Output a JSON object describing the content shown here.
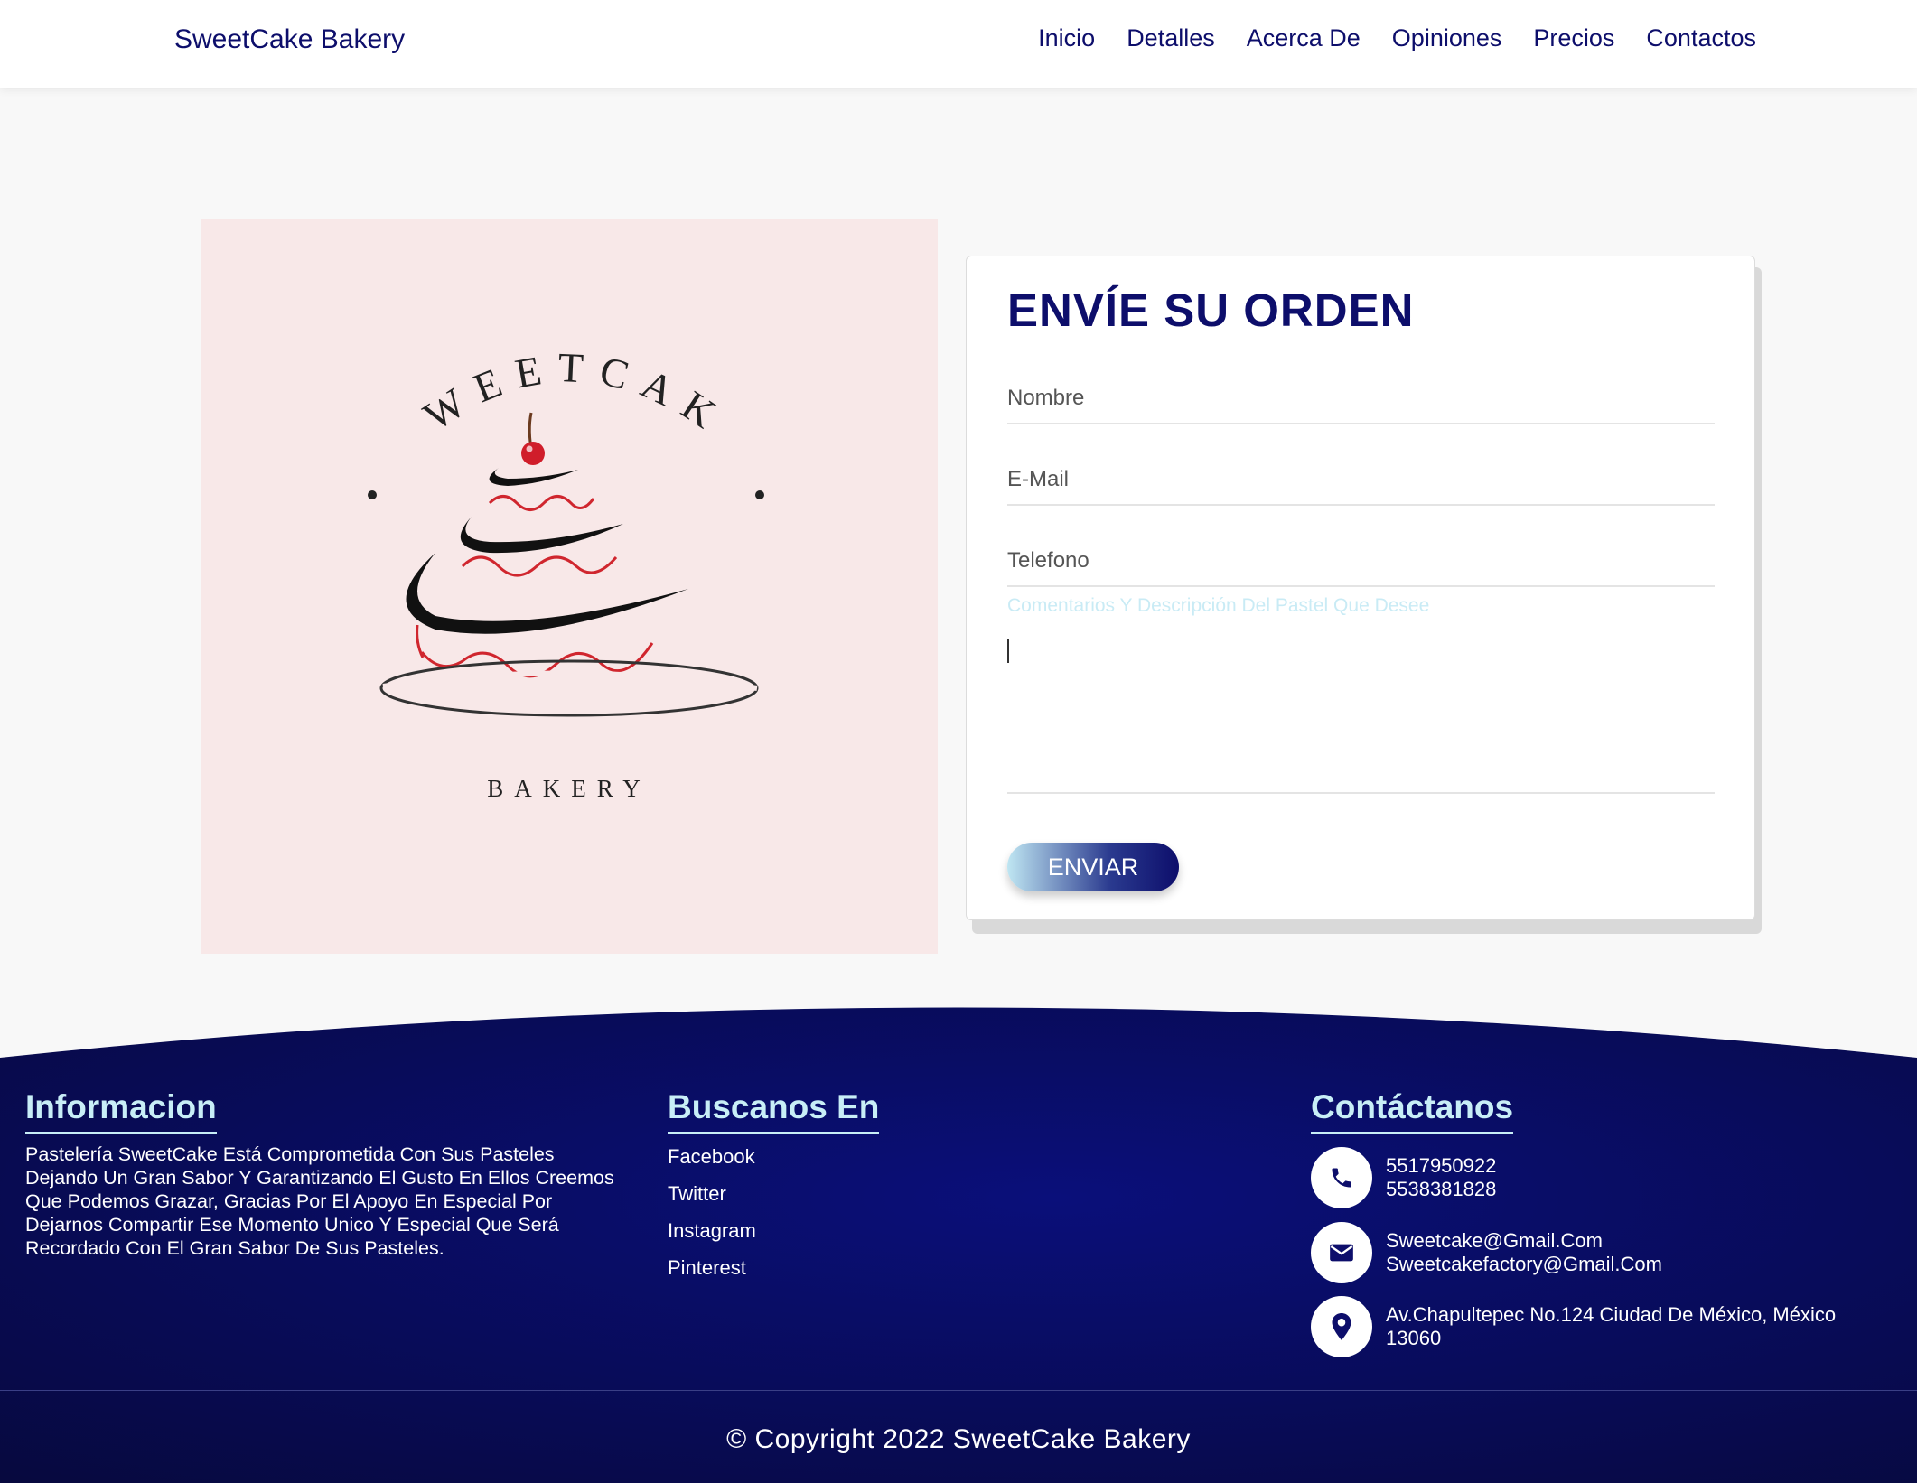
{
  "navbar": {
    "brand": "SweetCake Bakery",
    "links": [
      "Inicio",
      "Detalles",
      "Acerca De",
      "Opiniones",
      "Precios",
      "Contactos"
    ]
  },
  "logo": {
    "top_text": "SWEETCAKE",
    "bottom_text": "BAKERY"
  },
  "form": {
    "title": "ENVÍE SU ORDEN",
    "nombre_placeholder": "Nombre",
    "email_placeholder": "E-Mail",
    "telefono_placeholder": "Telefono",
    "comentarios_placeholder": "Comentarios Y Descripción Del Pastel Que Desee",
    "submit_label": "ENVIAR"
  },
  "footer": {
    "info": {
      "title": "Informacion",
      "text": "Pastelería SweetCake Está Comprometida Con Sus Pasteles Dejando Un Gran Sabor Y Garantizando El Gusto En Ellos Creemos Que Podemos Grazar, Gracias Por El Apoyo En Especial Por Dejarnos Compartir Ese Momento Unico Y Especial Que Será Recordado Con El Gran Sabor De Sus Pasteles."
    },
    "social": {
      "title": "Buscanos En",
      "links": [
        "Facebook",
        "Twitter",
        "Instagram",
        "Pinterest"
      ]
    },
    "contact": {
      "title": "Contáctanos",
      "phone_1": "5517950922",
      "phone_2": "5538381828",
      "email_1": "Sweetcake@Gmail.Com",
      "email_2": "Sweetcakefactory@Gmail.Com",
      "address_1": "Av.Chapultepec No.124 Ciudad De México, México",
      "address_2": "13060"
    },
    "copyright": "© Copyright 2022 SweetCake Bakery"
  },
  "colors": {
    "brand_navy": "#0d0e6b",
    "footer_bg": "#080a52",
    "accent_light_blue": "#c8eef7",
    "logo_bg": "#f8e8e8"
  },
  "icons": [
    "phone-icon",
    "envelope-icon",
    "map-pin-icon"
  ]
}
